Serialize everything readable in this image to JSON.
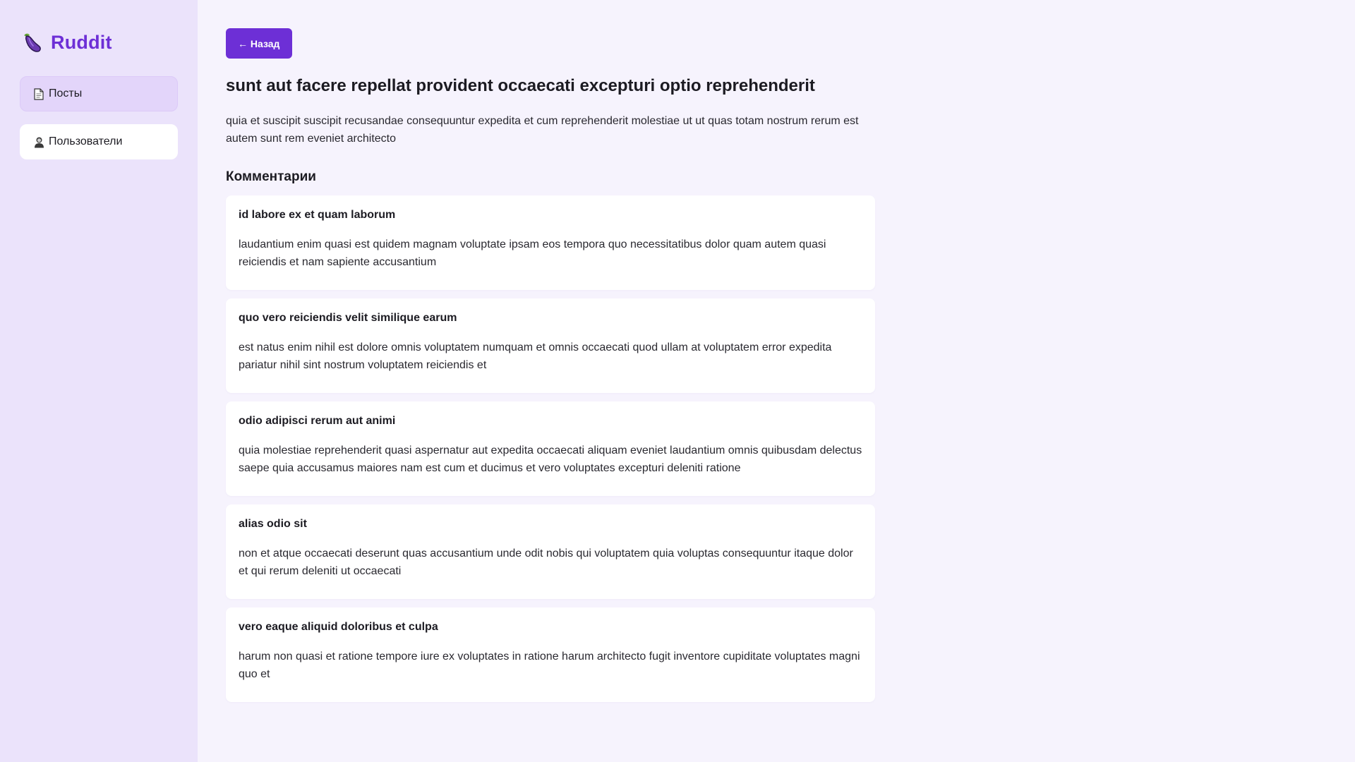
{
  "app": {
    "name": "Ruddit",
    "logo_icon": "eggplant-icon"
  },
  "colors": {
    "accent": "#6d2fd6",
    "sidebar_bg": "#ebe3fb",
    "page_bg": "#f6f3fd",
    "active_nav_bg": "#e3d5fa"
  },
  "sidebar": {
    "items": [
      {
        "label": "Посты",
        "icon": "page-icon",
        "active": true
      },
      {
        "label": "Пользователи",
        "icon": "user-icon",
        "active": false
      }
    ]
  },
  "main": {
    "back_label": "← Назад",
    "post": {
      "title": "sunt aut facere repellat provident occaecati excepturi optio reprehenderit",
      "body": "quia et suscipit suscipit recusandae consequuntur expedita et cum reprehenderit molestiae ut ut quas totam nostrum rerum est autem sunt rem eveniet architecto"
    },
    "comments_heading": "Комментарии",
    "comments": [
      {
        "name": "id labore ex et quam laborum",
        "body": "laudantium enim quasi est quidem magnam voluptate ipsam eos tempora quo necessitatibus dolor quam autem quasi reiciendis et nam sapiente accusantium"
      },
      {
        "name": "quo vero reiciendis velit similique earum",
        "body": "est natus enim nihil est dolore omnis voluptatem numquam et omnis occaecati quod ullam at voluptatem error expedita pariatur nihil sint nostrum voluptatem reiciendis et"
      },
      {
        "name": "odio adipisci rerum aut animi",
        "body": "quia molestiae reprehenderit quasi aspernatur aut expedita occaecati aliquam eveniet laudantium omnis quibusdam delectus saepe quia accusamus maiores nam est cum et ducimus et vero voluptates excepturi deleniti ratione"
      },
      {
        "name": "alias odio sit",
        "body": "non et atque occaecati deserunt quas accusantium unde odit nobis qui voluptatem quia voluptas consequuntur itaque dolor et qui rerum deleniti ut occaecati"
      },
      {
        "name": "vero eaque aliquid doloribus et culpa",
        "body": "harum non quasi et ratione tempore iure ex voluptates in ratione harum architecto fugit inventore cupiditate voluptates magni quo et"
      }
    ]
  }
}
